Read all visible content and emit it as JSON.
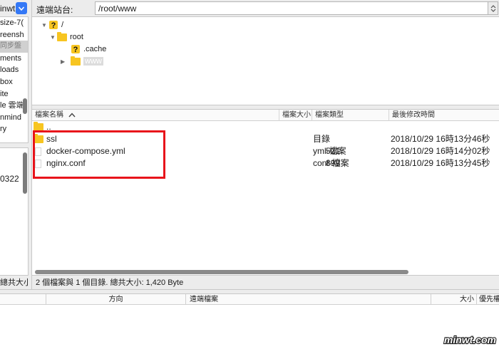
{
  "local": {
    "path_fragment": "inwt",
    "tree_items": [
      "size-7(",
      "reensh",
      "同步盤",
      "ments",
      "loads",
      "box",
      "ite",
      "le 雲端",
      "nmind",
      "ry"
    ],
    "selected_index": 2,
    "list_fragment": "0322",
    "status": "總共大小:"
  },
  "remote": {
    "site_label": "遠端站台:",
    "site_path": "/root/www",
    "tree": {
      "root_label": "/",
      "child_label": "root",
      "cache_label": ".cache",
      "www_label": "www"
    },
    "columns": {
      "name": "檔案名稱",
      "size": "檔案大小",
      "type": "檔案類型",
      "modified": "最後修改時間"
    },
    "files": [
      {
        "name": "..",
        "size": "",
        "type": "",
        "modified": "",
        "kind": "folder"
      },
      {
        "name": "ssl",
        "size": "",
        "type": "目錄",
        "modified": "2018/10/29 16時13分46秒",
        "kind": "folder"
      },
      {
        "name": "docker-compose.yml",
        "size": "521",
        "type": "yml-檔案",
        "modified": "2018/10/29 16時14分02秒",
        "kind": "file"
      },
      {
        "name": "nginx.conf",
        "size": "899",
        "type": "conf-檔案",
        "modified": "2018/10/29 16時13分45秒",
        "kind": "file"
      }
    ],
    "status": "2 個檔案與 1 個目錄. 總共大小: 1,420 Byte"
  },
  "queue": {
    "columns": {
      "direction": "方向",
      "remote_file": "遠端檔案",
      "size": "大小",
      "priority": "優先權"
    }
  },
  "watermark": "minwt.com",
  "colors": {
    "accent": "#3478f6",
    "folder": "#f7c521",
    "highlight_box": "#e8141b"
  }
}
